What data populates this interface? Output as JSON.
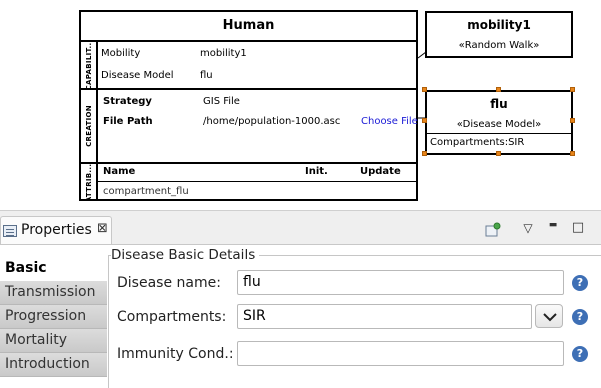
{
  "diagram": {
    "human": {
      "title": "Human",
      "capabilities": {
        "label": "CAPABILIT...",
        "rows": [
          {
            "name": "Mobility",
            "value": "mobility1"
          },
          {
            "name": "Disease Model",
            "value": "flu"
          }
        ]
      },
      "creation": {
        "label": "CREATION",
        "rows": [
          {
            "name": "Strategy",
            "value": "GIS File"
          },
          {
            "name": "File Path",
            "value": "/home/population-1000.asc",
            "action": "Choose File"
          }
        ]
      },
      "attributes": {
        "label": "ATTRIB...",
        "headers": {
          "name": "Name",
          "init": "Init.",
          "update": "Update"
        },
        "rows": [
          {
            "name": "compartment_flu"
          }
        ]
      }
    },
    "mobility_box": {
      "title": "mobility1",
      "stereotype": "«Random Walk»"
    },
    "disease_box": {
      "title": "flu",
      "stereotype": "«Disease Model»",
      "compartments": "Compartments:SIR"
    },
    "selection_handle_color": "#e8851a"
  },
  "properties": {
    "tab_title": "Properties",
    "close_glyph": "⊠",
    "toolbar": {
      "pin_icon": "pin-icon",
      "menu_glyph": "▽",
      "minimize_glyph": "▬",
      "maximize_glyph": "□"
    },
    "side_tabs": [
      {
        "label": "Basic",
        "active": true
      },
      {
        "label": "Transmission",
        "active": false
      },
      {
        "label": "Progression",
        "active": false
      },
      {
        "label": "Mortality",
        "active": false
      },
      {
        "label": "Introduction",
        "active": false
      }
    ],
    "group_title": "Disease Basic Details",
    "fields": {
      "disease_name": {
        "label": "Disease name:",
        "value": "flu"
      },
      "compartments": {
        "label": "Compartments:",
        "value": "SIR"
      },
      "immunity": {
        "label": "Immunity Cond.:",
        "value": ""
      }
    },
    "help_glyph": "?",
    "accent_color": "#3e6fb5"
  }
}
